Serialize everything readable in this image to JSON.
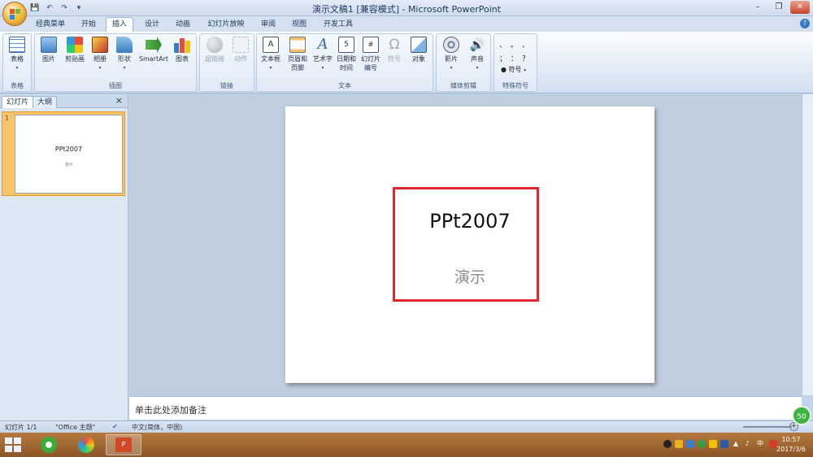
{
  "window": {
    "title": "演示文稿1 [兼容模式] - Microsoft PowerPoint",
    "minimize": "–",
    "restore": "❐",
    "close": "✕"
  },
  "tabs": [
    "经典菜单",
    "开始",
    "插入",
    "设计",
    "动画",
    "幻灯片放映",
    "审阅",
    "视图",
    "开发工具"
  ],
  "active_tab": "插入",
  "ribbon": {
    "groups": {
      "table": "表格",
      "illustrations": "插图",
      "links": "链接",
      "text": "文本",
      "media": "媒体剪辑",
      "special": "特殊符号"
    },
    "buttons": {
      "table": "表格",
      "picture": "图片",
      "clipart": "剪贴画",
      "album": "相册",
      "shapes": "形状",
      "smartart": "SmartArt",
      "chart": "图表",
      "hyperlink": "超链接",
      "action": "动作",
      "textbox": "文本框",
      "header_footer_1": "页眉和",
      "header_footer_2": "页脚",
      "wordart": "艺术字",
      "datetime_1": "日期和",
      "datetime_2": "时间",
      "slidenum_1": "幻灯片",
      "slidenum_2": "编号",
      "symbol": "符号",
      "object": "对象",
      "movie": "影片",
      "sound": "声音",
      "special_symbol": "符号"
    },
    "special_chars": [
      "、",
      "。",
      "、",
      "；",
      "：",
      "？"
    ]
  },
  "left_pane": {
    "tab_slides": "幻灯片",
    "tab_outline": "大纲",
    "close": "×",
    "slide_number": "1"
  },
  "slide": {
    "title": "PPt2007",
    "subtitle": "演示",
    "highlight_color": "#e2262e"
  },
  "notes_placeholder": "单击此处添加备注",
  "status": {
    "slide_count": "幻灯片 1/1",
    "theme": "\"Office 主题\"",
    "language": "中文(简体，中国)"
  },
  "taskbar": {
    "time": "10:57",
    "date": "2017/3/6",
    "ime": "中"
  },
  "badge": "50"
}
